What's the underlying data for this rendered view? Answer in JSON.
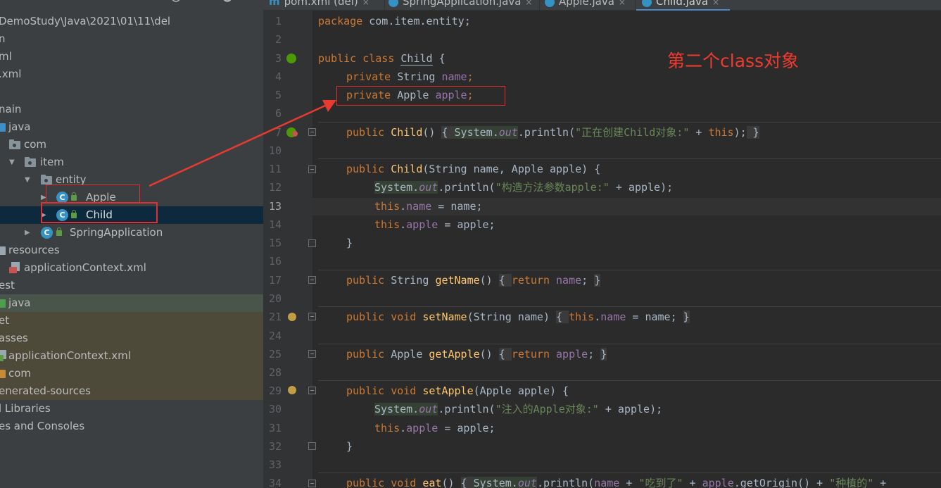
{
  "project": {
    "path": "DemoStudy\\Java\\2021\\01\\11\\del",
    "rows": [
      {
        "label": "DemoStudy\\Java\\2021\\01\\11\\del"
      },
      {
        "label": "n"
      },
      {
        "label": "ml"
      },
      {
        "label": ".xml"
      },
      {
        "label": ""
      },
      {
        "label": "nain"
      },
      {
        "label": "java"
      },
      {
        "label": "com"
      },
      {
        "label": "item"
      },
      {
        "label": "entity"
      },
      {
        "label": "Apple"
      },
      {
        "label": "Child"
      },
      {
        "label": "SpringApplication"
      },
      {
        "label": "resources"
      },
      {
        "label": "applicationContext.xml"
      },
      {
        "label": "est"
      },
      {
        "label": "java"
      },
      {
        "label": "et"
      },
      {
        "label": "asses"
      },
      {
        "label": "applicationContext.xml"
      },
      {
        "label": "com"
      },
      {
        "label": "enerated-sources"
      },
      {
        "label": "l Libraries"
      },
      {
        "label": "es and Consoles"
      }
    ],
    "class_icon_letter": "C"
  },
  "tabs": [
    {
      "label": "pom.xml (del)",
      "icon": "maven-icon",
      "icon_text": "m"
    },
    {
      "label": "SpringApplication.java",
      "icon": "class-icon"
    },
    {
      "label": "Apple.java",
      "icon": "class-icon"
    },
    {
      "label": "Child.java",
      "icon": "class-icon",
      "active": true
    }
  ],
  "tab_close": "×",
  "editor": {
    "current_line": 13,
    "lines": [
      {
        "n": "1"
      },
      {
        "n": "2"
      },
      {
        "n": "3"
      },
      {
        "n": "4"
      },
      {
        "n": "5"
      },
      {
        "n": "6"
      },
      {
        "n": "7"
      },
      {
        "n": "10"
      },
      {
        "n": "11"
      },
      {
        "n": "12"
      },
      {
        "n": "13"
      },
      {
        "n": "14"
      },
      {
        "n": "15"
      },
      {
        "n": "16"
      },
      {
        "n": "17"
      },
      {
        "n": "20"
      },
      {
        "n": "21"
      },
      {
        "n": "24"
      },
      {
        "n": "25"
      },
      {
        "n": "28"
      },
      {
        "n": "29"
      },
      {
        "n": "30"
      },
      {
        "n": "31"
      },
      {
        "n": "32"
      },
      {
        "n": "33"
      },
      {
        "n": "34"
      }
    ],
    "code": {
      "l1_kw": "package",
      "l1_rest": " com.item.entity;",
      "l3_kw": "public class ",
      "l3_name": "Child",
      "l3_rest": " {",
      "l4_kw": "private ",
      "l4_type": "String ",
      "l4_field": "name",
      "l4_end": ";",
      "l5_kw": "private ",
      "l5_type": "Apple ",
      "l5_field": "apple",
      "l5_end": ";",
      "l7_kw": "public ",
      "l7_fn": "Child",
      "l7_a": "() ",
      "l7_b": "{ ",
      "l7_sys": "System.",
      "l7_out": "out",
      "l7_c": ".println(",
      "l7_str": "\"正在创建Child对象:\"",
      "l7_d": " + ",
      "l7_this": "this",
      "l7_e": ");",
      "l7_f": " }",
      "l11_kw": "public ",
      "l11_fn": "Child",
      "l11_rest": "(String name, Apple apple) {",
      "l12_sys": "System.",
      "l12_out": "out",
      "l12_a": ".println(",
      "l12_str": "\"构造方法参数apple:\"",
      "l12_b": " + apple);",
      "l13_this": "this",
      "l13_a": ".",
      "l13_field": "name",
      "l13_b": " = name;",
      "l14_this": "this",
      "l14_a": ".",
      "l14_field": "apple",
      "l14_b": " = apple;",
      "l15": "}",
      "l17_kw": "public ",
      "l17_type": "String ",
      "l17_fn": "getName",
      "l17_a": "() ",
      "l17_b": "{ ",
      "l17_ret": "return ",
      "l17_field": "name",
      "l17_c": "; ",
      "l17_d": "}",
      "l21_kw": "public void ",
      "l21_fn": "setName",
      "l21_a": "(String name) ",
      "l21_b": "{ ",
      "l21_this": "this",
      "l21_c": ".",
      "l21_field": "name",
      "l21_d": " = name; ",
      "l21_e": "}",
      "l25_kw": "public ",
      "l25_type": "Apple ",
      "l25_fn": "getApple",
      "l25_a": "() ",
      "l25_b": "{ ",
      "l25_ret": "return ",
      "l25_field": "apple",
      "l25_c": "; ",
      "l25_d": "}",
      "l29_kw": "public void ",
      "l29_fn": "setApple",
      "l29_rest": "(Apple apple) {",
      "l30_sys": "System.",
      "l30_out": "out",
      "l30_a": ".println(",
      "l30_str": "\"注入的Apple对象:\"",
      "l30_b": " + apple);",
      "l31_this": "this",
      "l31_a": ".",
      "l31_field": "apple",
      "l31_b": " = apple;",
      "l32": "}",
      "l34_kw": "public void ",
      "l34_fn": "eat",
      "l34_a": "() ",
      "l34_b": "{ ",
      "l34_sys": "System.",
      "l34_out": "out",
      "l34_c": ".println(",
      "l34_field1": "name",
      "l34_d": " + ",
      "l34_str1": "\"吃到了\"",
      "l34_e": " + ",
      "l34_field2": "apple",
      "l34_f": ".getOrigin() + ",
      "l34_str2": "\"种植的\"",
      "l34_g": " + "
    }
  },
  "annotation": {
    "text": "第二个class对象",
    "color": "#f03a2e"
  },
  "colors": {
    "keyword": "#cc7832",
    "method": "#ffc66d",
    "field": "#9876aa",
    "string": "#6a8759",
    "text": "#a9b7c6",
    "selection": "#0d293e"
  }
}
